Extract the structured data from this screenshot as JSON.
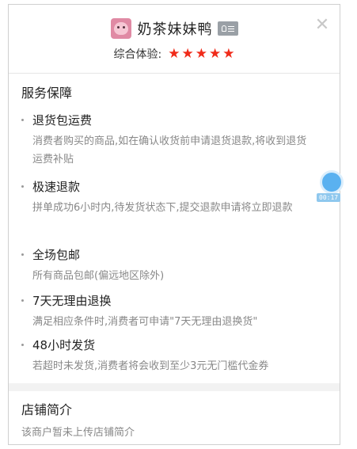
{
  "shop": {
    "name": "奶茶妹妹鸭",
    "rating_label": "综合体验:",
    "rating_stars": 5,
    "star_color": "#f02b1a"
  },
  "close_icon": "close-icon",
  "service": {
    "title": "服务保障",
    "items": [
      {
        "title": "退货包运费",
        "desc": "消费者购买的商品,如在确认收货前申请退货退款,将收到退货运费补贴"
      },
      {
        "title": "极速退款",
        "desc": "拼单成功6小时内,待发货状态下,提交退款申请将立即退款"
      },
      {
        "title": "全场包邮",
        "desc": "所有商品包邮(偏远地区除外)"
      },
      {
        "title": "7天无理由退换",
        "desc": "满足相应条件时,消费者可申请\"7天无理由退换货\""
      },
      {
        "title": "48小时发货",
        "desc": "若超时未发货,消费者将会收到至少3元无门槛代金券"
      }
    ]
  },
  "intro": {
    "title": "店铺简介",
    "desc": "该商户暂未上传店铺简介"
  },
  "float": {
    "time": "00:17",
    "color": "#5ab1f0"
  }
}
